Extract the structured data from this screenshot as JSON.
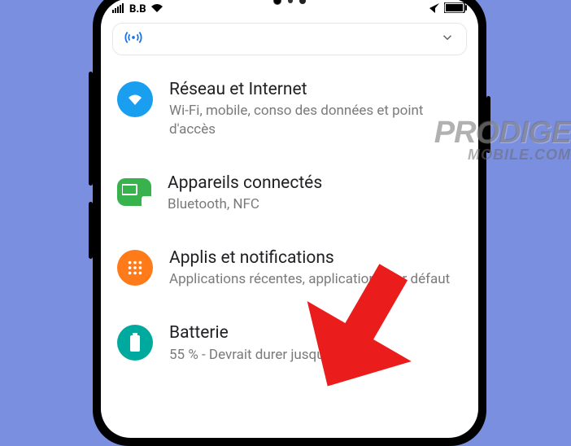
{
  "statusbar": {
    "carrier": "B.B"
  },
  "card": {
    "icon": "hotspot-icon",
    "chevron": "chevron-down-icon"
  },
  "items": [
    {
      "icon": "wifi-icon",
      "color": "#1a9ff0",
      "title": "Réseau et Internet",
      "subtitle": "Wi-Fi, mobile, conso des données et point d'accès"
    },
    {
      "icon": "devices-icon",
      "color": "#38b24d",
      "title": "Appareils connectés",
      "subtitle": "Bluetooth, NFC"
    },
    {
      "icon": "apps-icon",
      "color": "#ff7a18",
      "title": "Applis et notifications",
      "subtitle": "Applications récentes, applications par défaut"
    },
    {
      "icon": "battery-icon",
      "color": "#00a99d",
      "title": "Batterie",
      "subtitle": "55 % - Devrait durer jusqu'à environ"
    }
  ],
  "watermark": {
    "line1": "PRODIGE",
    "line2": "MOBILE.COM"
  }
}
